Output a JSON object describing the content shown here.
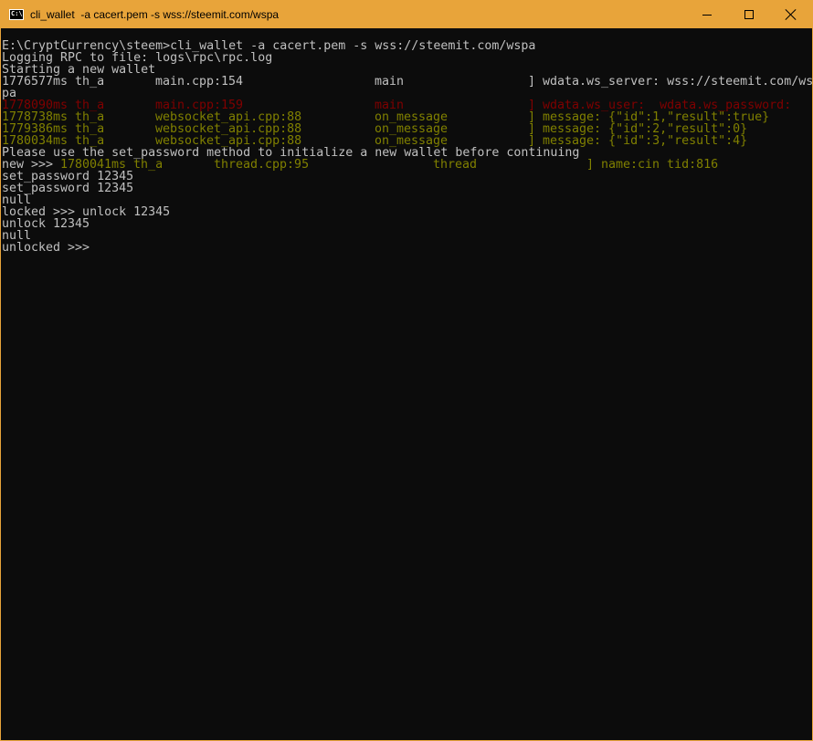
{
  "window": {
    "title": "cli_wallet  -a cacert.pem -s wss://steemit.com/wspa",
    "icon": "console-icon",
    "icon_text": "C:\\",
    "controls": [
      "minimize-icon",
      "maximize-icon",
      "close-icon"
    ],
    "accent": "#e8a43a",
    "background": "#0c0c0c"
  },
  "console": {
    "colors": {
      "default": "#c0c0c0",
      "error": "#800000",
      "info": "#808000"
    },
    "lines": {
      "l0": "E:\\CryptCurrency\\steem>cli_wallet -a cacert.pem -s wss://steemit.com/wspa",
      "l1": "Logging RPC to file: logs\\rpc\\rpc.log",
      "l2": "Starting a new wallet",
      "l3": {
        "time": "1776577ms th_a",
        "file": "main.cpp:154",
        "func": "main",
        "msg": "] wdata.ws_server: wss://steemit.com/ws"
      },
      "l3b": "pa",
      "l4": {
        "time": "1778090ms th_a",
        "file": "main.cpp:159",
        "func": "main",
        "msg": "] wdata.ws_user:  wdata.ws_password:"
      },
      "l5": {
        "time": "1778738ms th_a",
        "file": "websocket_api.cpp:88",
        "func": "on_message",
        "msg": "] message: {\"id\":1,\"result\":true}"
      },
      "l6": {
        "time": "1779386ms th_a",
        "file": "websocket_api.cpp:88",
        "func": "on_message",
        "msg": "] message: {\"id\":2,\"result\":0}"
      },
      "l7": {
        "time": "1780034ms th_a",
        "file": "websocket_api.cpp:88",
        "func": "on_message",
        "msg": "] message: {\"id\":3,\"result\":4}"
      },
      "l8": "Please use the set_password method to initialize a new wallet before continuing",
      "l9": {
        "prompt": "new >>> ",
        "time": "1780041ms th_a",
        "file": "thread.cpp:95",
        "func": "thread",
        "msg": "] name:cin tid:816"
      },
      "l10": "set_password 12345",
      "l11": "set_password 12345",
      "l12": "null",
      "l13": "locked >>> unlock 12345",
      "l14": "unlock 12345",
      "l15": "null",
      "l16": "unlocked >>> "
    }
  }
}
